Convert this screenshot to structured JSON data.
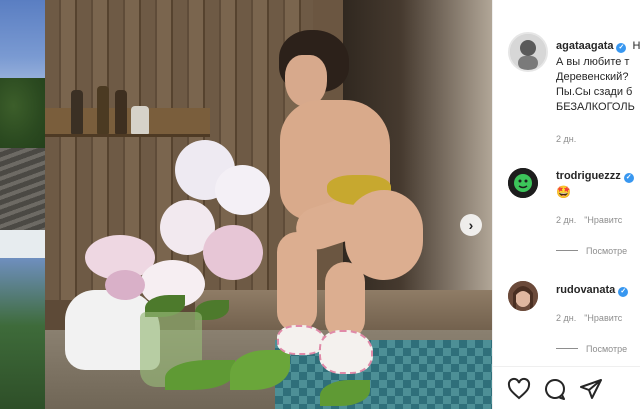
{
  "post": {
    "author": "agataagata",
    "caption_lines": [
      "Н",
      "А вы любите т",
      "Деревенский?",
      "Пы.Сы сзади б",
      "БЕЗАЛКОГОЛЬ"
    ],
    "time": "2 дн."
  },
  "comments": [
    {
      "username": "trodriguezzz",
      "text": "🤩",
      "time": "2 дн.",
      "like_label": "\"Нравитс",
      "replies_label": "Посмотре"
    },
    {
      "username": "rudovanata",
      "text": "",
      "time": "2 дн.",
      "like_label": "\"Нравитс",
      "replies_label": "Посмотре"
    }
  ],
  "nav": {
    "next_icon": "chevron-right-icon"
  },
  "actions": [
    "heart-icon",
    "comment-icon",
    "share-icon"
  ],
  "colors": {
    "verified": "#3897f0",
    "text": "#262626",
    "muted": "#8e8e8e"
  }
}
